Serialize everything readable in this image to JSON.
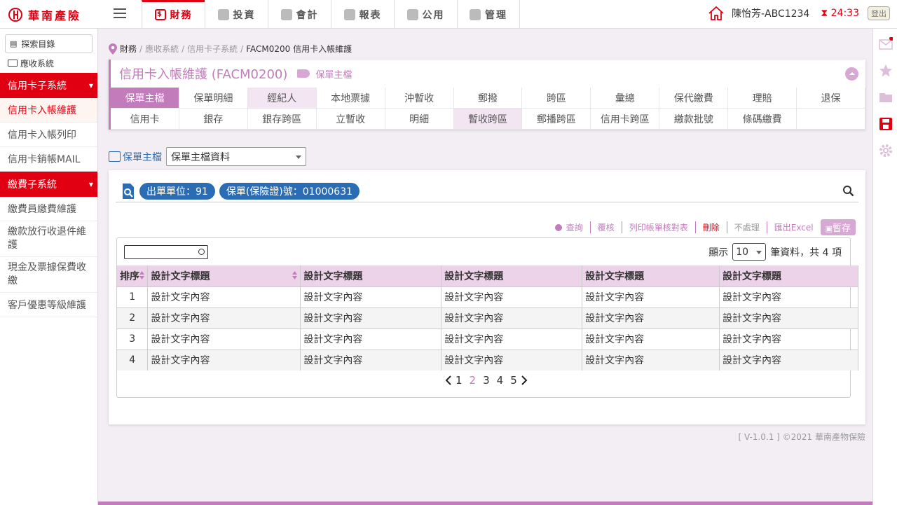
{
  "app": {
    "logo_text": "華南產險"
  },
  "nav": {
    "tabs": [
      {
        "label": "財務",
        "icon": "dollar-icon"
      },
      {
        "label": "投資",
        "icon": "trophy-icon"
      },
      {
        "label": "會計",
        "icon": "chart-icon"
      },
      {
        "label": "報表",
        "icon": "document-icon"
      },
      {
        "label": "公用",
        "icon": "users-icon"
      },
      {
        "label": "管理",
        "icon": "grid-icon"
      }
    ]
  },
  "user": {
    "name": "陳怡芳-ABC1234",
    "timer": "24:33",
    "logout": "登出"
  },
  "sidebar": {
    "explore": "探索目錄",
    "folder": "應收系統",
    "section1": "信用卡子系統",
    "items1": [
      "信用卡入帳維護",
      "信用卡入帳列印",
      "信用卡銷帳MAIL"
    ],
    "section2": "繳費子系統",
    "items2": [
      "繳費員繳費維護",
      "繳款放行收退件維護",
      "現金及票據保費收繳",
      "客戶優惠等級維護"
    ]
  },
  "breadcrumb": [
    "財務",
    "應收系統",
    "信用卡子系統",
    "FACM0200 信用卡入帳維護"
  ],
  "page": {
    "title": "信用卡入帳維護 (FACM0200)",
    "tag": "保單主檔"
  },
  "tabs_row1": [
    "保單主檔",
    "保單明細",
    "經紀人",
    "本地票據",
    "沖暫收",
    "郵撥",
    "跨區",
    "彙總",
    "保代繳費",
    "理賠",
    "退保"
  ],
  "tabs_row2": [
    "信用卡",
    "銀存",
    "銀存跨區",
    "立暫收",
    "明細",
    "暫收跨區",
    "郵播跨區",
    "信用卡跨區",
    "繳款批號",
    "條碼繳費",
    ""
  ],
  "selector": {
    "label": "保單主檔",
    "value": "保單主檔資料"
  },
  "filters": {
    "chip1": "出單單位：91",
    "chip2": "保單(保險證)號：01000631"
  },
  "actions": {
    "query": "查詢",
    "review": "覆核",
    "print": "列印帳單核對表",
    "delete": "刪除",
    "skip": "不處理",
    "export": "匯出Excel",
    "save": "暫存"
  },
  "table": {
    "show_label": "顯示",
    "page_size": "10",
    "total_label": "筆資料，共 4 項",
    "columns": [
      "排序",
      "設計文字標題",
      "設計文字標題",
      "設計文字標題",
      "設計文字標題",
      "設計文字標題"
    ],
    "rows": [
      [
        "1",
        "設計文字內容",
        "設計文字內容",
        "設計文字內容",
        "設計文字內容",
        "設計文字內容"
      ],
      [
        "2",
        "設計文字內容",
        "設計文字內容",
        "設計文字內容",
        "設計文字內容",
        "設計文字內容"
      ],
      [
        "3",
        "設計文字內容",
        "設計文字內容",
        "設計文字內容",
        "設計文字內容",
        "設計文字內容"
      ],
      [
        "4",
        "設計文字內容",
        "設計文字內容",
        "設計文字內容",
        "設計文字內容",
        "設計文字內容"
      ]
    ]
  },
  "pagination": {
    "pages": [
      "1",
      "2",
      "3",
      "4",
      "5"
    ],
    "current": "2"
  },
  "footer": "[ V-1.0.1 ] ©2021 華南產物保險",
  "colors": {
    "brand_red": "#e00012",
    "accent_pink": "#c27cbb",
    "chip_blue": "#2a6db5"
  }
}
